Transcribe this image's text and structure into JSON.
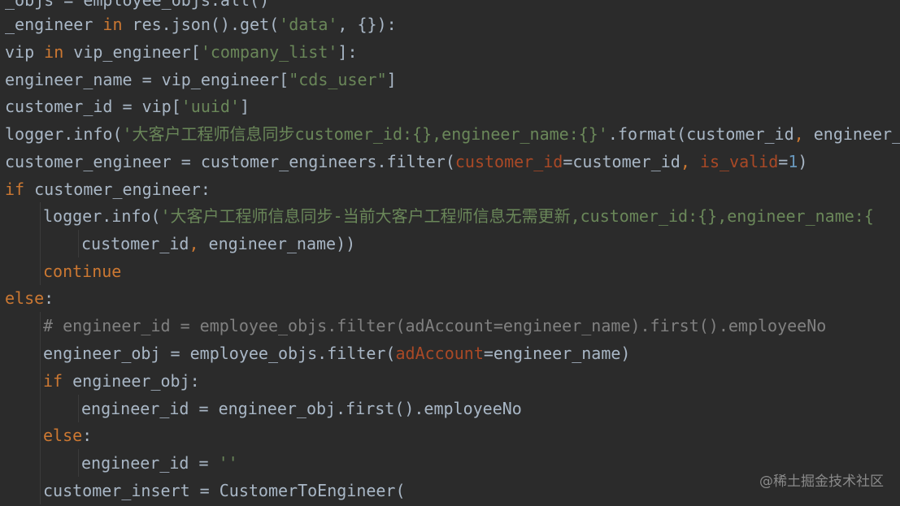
{
  "editor": {
    "theme_colors": {
      "background": "#2b2b2b",
      "keyword": "#cc7832",
      "string": "#6a8759",
      "number": "#6897bb",
      "param": "#aa4926",
      "comment": "#808080",
      "plain": "#a9b7c6"
    },
    "lines": [
      [
        {
          "t": "_objs = employee_objs.all()",
          "c": "plain"
        }
      ],
      [
        {
          "t": "_engineer ",
          "c": "plain"
        },
        {
          "t": "in",
          "c": "kw"
        },
        {
          "t": " res.json().get(",
          "c": "plain"
        },
        {
          "t": "'data'",
          "c": "str"
        },
        {
          "t": ", {}):",
          "c": "plain"
        }
      ],
      [
        {
          "t": "vip ",
          "c": "plain"
        },
        {
          "t": "in",
          "c": "kw"
        },
        {
          "t": " vip_engineer[",
          "c": "plain"
        },
        {
          "t": "'company_list'",
          "c": "str"
        },
        {
          "t": "]:",
          "c": "plain"
        }
      ],
      [
        {
          "t": "engineer_name = vip_engineer[",
          "c": "plain"
        },
        {
          "t": "\"cds_user\"",
          "c": "str"
        },
        {
          "t": "]",
          "c": "plain"
        }
      ],
      [
        {
          "t": "customer_id = vip[",
          "c": "plain"
        },
        {
          "t": "'uuid'",
          "c": "str"
        },
        {
          "t": "]",
          "c": "plain"
        }
      ],
      [
        {
          "t": "logger.info(",
          "c": "plain"
        },
        {
          "t": "'大客户工程师信息同步customer_id:{},engineer_name:{}'",
          "c": "str"
        },
        {
          "t": ".format(customer_id",
          "c": "plain"
        },
        {
          "t": ", ",
          "c": "kw"
        },
        {
          "t": "engineer_",
          "c": "plain"
        }
      ],
      [
        {
          "t": "customer_engineer = customer_engineers.filter(",
          "c": "plain"
        },
        {
          "t": "customer_id",
          "c": "param"
        },
        {
          "t": "=customer_id",
          "c": "plain"
        },
        {
          "t": ", ",
          "c": "kw"
        },
        {
          "t": "is_valid",
          "c": "param"
        },
        {
          "t": "=",
          "c": "plain"
        },
        {
          "t": "1",
          "c": "num"
        },
        {
          "t": ")",
          "c": "plain"
        }
      ],
      [
        {
          "t": "if",
          "c": "kw"
        },
        {
          "t": " customer_engineer:",
          "c": "plain"
        }
      ],
      [
        {
          "t": "logger.info(",
          "c": "plain"
        },
        {
          "t": "'大客户工程师信息同步-当前大客户工程师信息无需更新,customer_id:{},engineer_name:{",
          "c": "str"
        }
      ],
      [
        {
          "t": "customer_id",
          "c": "plain"
        },
        {
          "t": ", ",
          "c": "kw"
        },
        {
          "t": "engineer_name))",
          "c": "plain"
        }
      ],
      [
        {
          "t": "continue",
          "c": "kw"
        }
      ],
      [
        {
          "t": "else",
          "c": "kw"
        },
        {
          "t": ":",
          "c": "plain"
        }
      ],
      [
        {
          "t": "# engineer_id = employee_objs.filter(adAccount=engineer_name).first().employeeNo",
          "c": "comment"
        }
      ],
      [
        {
          "t": "engineer_obj = employee_objs.filter(",
          "c": "plain"
        },
        {
          "t": "adAccount",
          "c": "param"
        },
        {
          "t": "=engineer_name)",
          "c": "plain"
        }
      ],
      [
        {
          "t": "if",
          "c": "kw"
        },
        {
          "t": " engineer_obj:",
          "c": "plain"
        }
      ],
      [
        {
          "t": "engineer_id = engineer_obj.first().employeeNo",
          "c": "plain"
        }
      ],
      [
        {
          "t": "else",
          "c": "kw"
        },
        {
          "t": ":",
          "c": "plain"
        }
      ],
      [
        {
          "t": "engineer_id = ",
          "c": "plain"
        },
        {
          "t": "''",
          "c": "str"
        }
      ],
      [
        {
          "t": "customer_insert = CustomerToEngineer(",
          "c": "plain"
        }
      ]
    ]
  },
  "watermark": "@稀土掘金技术社区"
}
